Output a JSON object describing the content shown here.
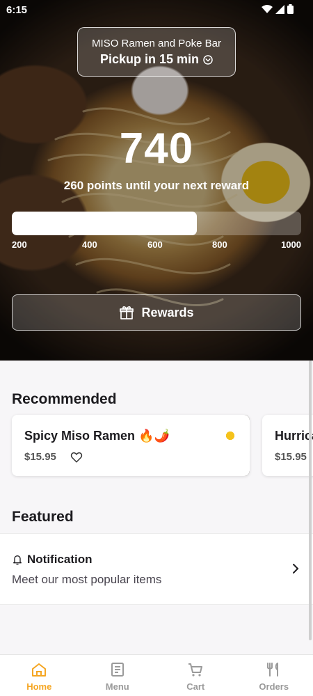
{
  "status_bar": {
    "time": "6:15"
  },
  "store": {
    "name": "MISO Ramen and Poke Bar",
    "pickup": "Pickup in 15 min"
  },
  "rewards": {
    "points": "740",
    "points_message": "260 points until your next reward",
    "progress_fraction": 0.64,
    "ticks": [
      "200",
      "400",
      "600",
      "800",
      "1000"
    ],
    "button_label": "Rewards"
  },
  "recommended": {
    "title": "Recommended",
    "items": [
      {
        "name": "Spicy Miso Ramen 🔥🌶️",
        "price": "$15.95"
      },
      {
        "name": "Hurrica",
        "price": "$15.95"
      }
    ]
  },
  "featured": {
    "title": "Featured",
    "item": {
      "title": "Notification",
      "subtitle": "Meet our most popular items"
    }
  },
  "nav": {
    "items": [
      {
        "label": "Home",
        "icon": "home-icon",
        "active": true
      },
      {
        "label": "Menu",
        "icon": "menu-icon",
        "active": false
      },
      {
        "label": "Cart",
        "icon": "cart-icon",
        "active": false
      },
      {
        "label": "Orders",
        "icon": "fork-knife-icon",
        "active": false
      }
    ]
  },
  "colors": {
    "accent": "#f5a623",
    "inactive": "#9a9a9a"
  }
}
